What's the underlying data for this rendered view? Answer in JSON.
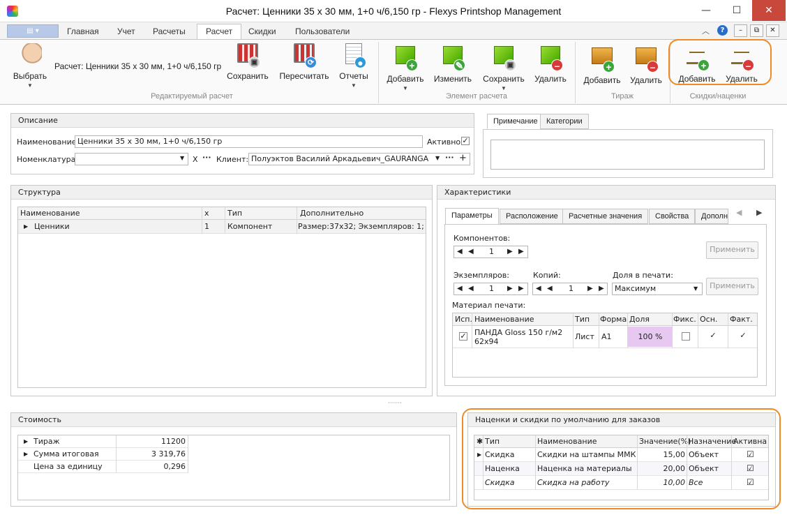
{
  "window": {
    "title": "Расчет: Ценники 35 х 30 мм, 1+0 ч/6,150 гр - Flexys Printshop Management",
    "min": "—",
    "max": "☐",
    "close": "✕"
  },
  "ribbon_tabs": [
    "Главная",
    "Учет",
    "Расчеты",
    "Расчет",
    "Скидки",
    "Пользователи"
  ],
  "ribbon_active_tab": "Расчет",
  "ribbon": {
    "choose_label": "Выбрать",
    "calc_caption": "Расчет: Ценники 35 х 30 мм, 1+0 ч/6,150 гр",
    "group1": {
      "label": "Редактируемый расчет",
      "save": "Сохранить",
      "recalc": "Пересчитать",
      "reports": "Отчеты"
    },
    "group2": {
      "label": "Элемент расчета",
      "add": "Добавить",
      "edit": "Изменить",
      "save": "Сохранить",
      "delete": "Удалить"
    },
    "group3": {
      "label": "Тираж",
      "add": "Добавить",
      "delete": "Удалить"
    },
    "group4": {
      "label": "Скидки/наценки",
      "add": "Добавить",
      "delete": "Удалить"
    }
  },
  "description": {
    "header": "Описание",
    "name_label": "Наименование:",
    "name_value": "Ценники 35 х 30 мм, 1+0 ч/6,150 гр",
    "active_label": "Активно",
    "nomenclature_label": "Номенклатура:",
    "nomenclature_value": "",
    "clear_x": "X",
    "client_label": "Клиент:",
    "client_value": "Полуэктов Василий Аркадьевич_GAURANGA"
  },
  "note_tabs": [
    "Примечание",
    "Категории"
  ],
  "structure": {
    "header": "Структура",
    "columns": [
      "Наименование",
      "x",
      "Тип",
      "Дополнительно"
    ],
    "rows": [
      {
        "name": "Ценники",
        "x": "1",
        "type": "Компонент",
        "extra": "Размер:37x32; Экземпляров: 1;"
      }
    ]
  },
  "characteristics": {
    "header": "Характеристики",
    "tabs": [
      "Параметры",
      "Расположение",
      "Расчетные значения",
      "Свойства",
      "Дополн"
    ],
    "components_label": "Компонентов:",
    "components_value": "1",
    "apply": "Применить",
    "copies_label": "Экземпляров:",
    "copies_value": "1",
    "prints_label": "Копий:",
    "prints_value": "1",
    "share_label": "Доля в печати:",
    "share_value": "Максимум",
    "material_label": "Материал печати:",
    "material_columns": [
      "Исп.",
      "Наименование",
      "Тип",
      "Формат",
      "Доля",
      "Фикс.",
      "Осн.",
      "Факт."
    ],
    "material_rows": [
      {
        "name1": "ПАНДА Gloss 150 г/м2",
        "name2": "62х94",
        "type": "Лист",
        "format": "A1",
        "share": "100 %"
      }
    ]
  },
  "cost": {
    "header": "Стоимость",
    "rows": [
      {
        "label": "Тираж",
        "value": "11200"
      },
      {
        "label": "Сумма итоговая",
        "value": "3 319,76"
      },
      {
        "label": "Цена за единицу",
        "value": "0,296"
      }
    ]
  },
  "discounts": {
    "header": "Наценки и скидки по умолчанию для заказов",
    "columns": [
      "Тип",
      "Наименование",
      "Значение(%)",
      "Назначение",
      "Активна"
    ],
    "rows": [
      {
        "type": "Скидка",
        "name": "Скидки на штампы ММК",
        "value": "15,00",
        "target": "Объект"
      },
      {
        "type": "Наценка",
        "name": "Наценка на материалы",
        "value": "20,00",
        "target": "Объект"
      },
      {
        "type": "Скидка",
        "name": "Скидка на работу",
        "value": "10,00",
        "target": "Все"
      }
    ]
  },
  "colors": {
    "highlight_orange": "#f08a24",
    "share_cell": "#e6c8f0",
    "close_red": "#c9483c"
  }
}
